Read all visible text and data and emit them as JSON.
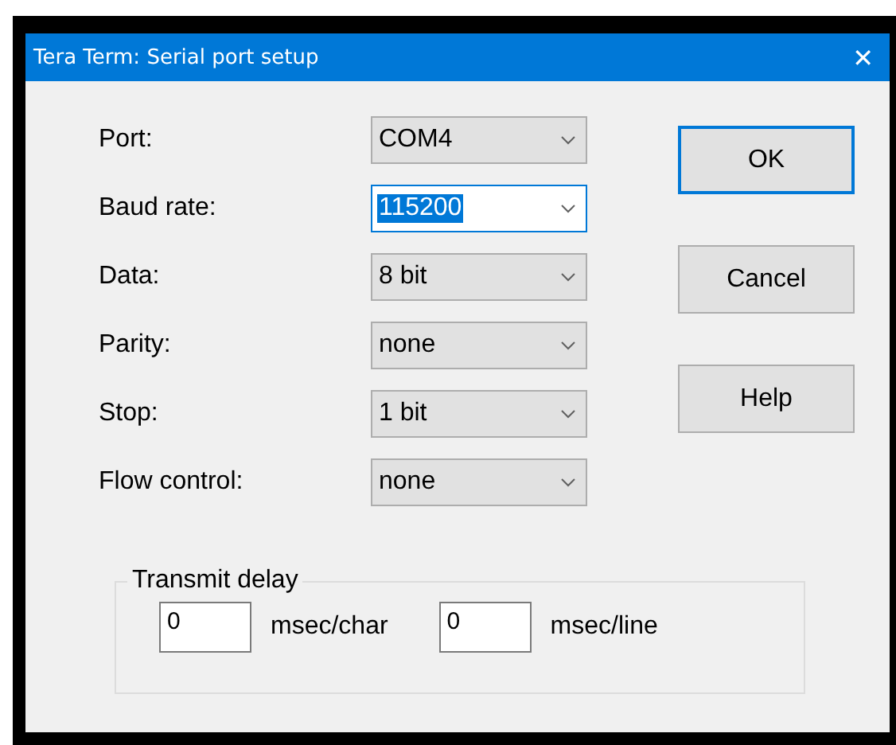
{
  "window": {
    "title": "Tera Term: Serial port setup",
    "close": "✕"
  },
  "settings": [
    {
      "label": "Port:",
      "value": "COM4",
      "focused": false
    },
    {
      "label": "Baud rate:",
      "value": "115200",
      "focused": true
    },
    {
      "label": "Data:",
      "value": "8 bit",
      "focused": false
    },
    {
      "label": "Parity:",
      "value": "none",
      "focused": false
    },
    {
      "label": "Stop:",
      "value": "1 bit",
      "focused": false
    },
    {
      "label": "Flow control:",
      "value": "none",
      "focused": false
    }
  ],
  "buttons": [
    {
      "label": "OK",
      "default": true
    },
    {
      "label": "Cancel",
      "default": false
    },
    {
      "label": "Help",
      "default": false
    }
  ],
  "transmit_delay": {
    "title": "Transmit delay",
    "fields": [
      {
        "value": "0",
        "unit": "msec/char"
      },
      {
        "value": "0",
        "unit": "msec/line"
      }
    ]
  }
}
